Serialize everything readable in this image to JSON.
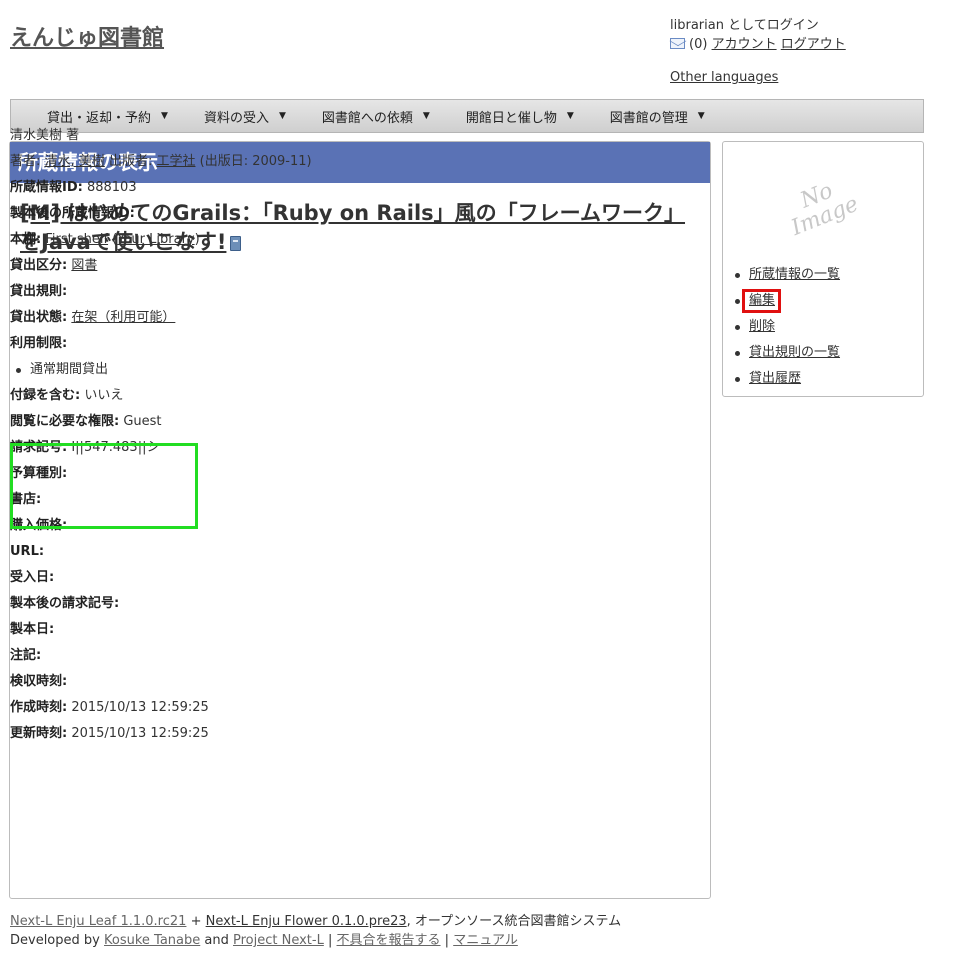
{
  "header": {
    "site_title": "えんじゅ図書館",
    "login_status": "librarian としてログイン",
    "message_count": "(0)",
    "account_link": "アカウント",
    "logout_link": "ログアウト",
    "other_languages": "Other languages"
  },
  "nav": {
    "items": [
      {
        "label": "貸出・返却・予約"
      },
      {
        "label": "資料の受入"
      },
      {
        "label": "図書館への依頼"
      },
      {
        "label": "開館日と催し物"
      },
      {
        "label": "図書館の管理"
      }
    ]
  },
  "main": {
    "header": "所蔵情報の表示",
    "title_link": "[M] はじめてのGrails：「Ruby on Rails」風の「フレームワーク」をJavaで使いこなす!",
    "statement_of_responsibility": "清水美樹 著",
    "author_label": "著者:",
    "author_value": "清水, 美樹",
    "publisher_label": "出版者:",
    "publisher_value": "工学社",
    "pub_date": "(出版日: 2009-11)",
    "fields": {
      "item_id": {
        "label": "所蔵情報ID:",
        "value": "888103"
      },
      "bound_item_id": {
        "label": "製本後の所蔵情報ID:",
        "value": ""
      },
      "shelf": {
        "label": "本棚:",
        "value": "First shelf",
        "library": "Your Library"
      },
      "checkout_type": {
        "label": "貸出区分:",
        "value": "図書"
      },
      "lending_rule": {
        "label": "貸出規則:",
        "value": ""
      },
      "circulation_status": {
        "label": "貸出状態:",
        "value": "在架（利用可能）"
      },
      "use_restriction": {
        "label": "利用制限:",
        "value": ""
      },
      "restriction_item": "通常期間貸出",
      "include_supplements": {
        "label": "付録を含む:",
        "value": "いいえ"
      },
      "required_role": {
        "label": "閲覧に必要な権限:",
        "value": "Guest"
      },
      "call_number": {
        "label": "請求記号:",
        "value": "I||547.483||シ"
      },
      "budget_type": {
        "label": "予算種別:",
        "value": ""
      },
      "bookstore": {
        "label": "書店:",
        "value": ""
      },
      "price": {
        "label": "購入価格:",
        "value": ""
      },
      "url": {
        "label": "URL:",
        "value": ""
      },
      "acquired_at": {
        "label": "受入日:",
        "value": ""
      },
      "binding_call_number": {
        "label": "製本後の請求記号:",
        "value": ""
      },
      "binded_at": {
        "label": "製本日:",
        "value": ""
      },
      "note": {
        "label": "注記:",
        "value": ""
      },
      "inspected_at": {
        "label": "検収時刻:",
        "value": ""
      },
      "created_at": {
        "label": "作成時刻:",
        "value": "2015/10/13 12:59:25"
      },
      "updated_at": {
        "label": "更新時刻:",
        "value": "2015/10/13 12:59:25"
      }
    }
  },
  "sidebar": {
    "no_image_line1": "No",
    "no_image_line2": "Image",
    "links": [
      {
        "label": "所蔵情報の一覧"
      },
      {
        "label": "編集"
      },
      {
        "label": "削除"
      },
      {
        "label": "貸出規則の一覧"
      },
      {
        "label": "貸出履歴"
      }
    ]
  },
  "footer": {
    "leaf": "Next-L Enju Leaf 1.1.0.rc21",
    "plus": "+",
    "flower": "Next-L Enju Flower 0.1.0.pre23",
    "system_desc": ", オープンソース統合図書館システム",
    "developed_by": "Developed by",
    "developer": "Kosuke Tanabe",
    "and": "and",
    "project": "Project Next-L",
    "sep": "|",
    "report_bug": "不具合を報告する",
    "manual": "マニュアル"
  },
  "colors": {
    "panel_header_bg": "#5a72b5",
    "green_highlight": "#22dd22",
    "red_highlight": "#e01010"
  }
}
